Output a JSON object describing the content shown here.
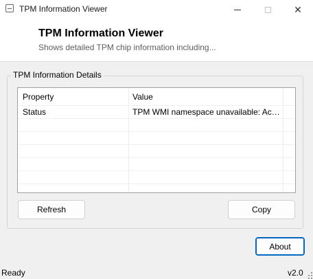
{
  "window": {
    "title": "TPM Information Viewer",
    "minimize_icon": "minimize-icon",
    "maximize_icon": "maximize-icon",
    "close_glyph": "✕"
  },
  "header": {
    "title": "TPM Information Viewer",
    "subtitle": "Shows detailed TPM chip information including..."
  },
  "group": {
    "title": "TPM Information Details",
    "table": {
      "columns": [
        "Property",
        "Value"
      ],
      "rows": [
        [
          "Status",
          "TPM WMI namespace unavailable: Access denied"
        ]
      ]
    }
  },
  "buttons": {
    "refresh": "Refresh",
    "copy": "Copy",
    "about": "About"
  },
  "statusbar": {
    "status": "Ready",
    "version": "v2.0"
  },
  "colors": {
    "accent": "#0067c0",
    "background": "#f0f0f0",
    "header_background": "#ffffff"
  }
}
